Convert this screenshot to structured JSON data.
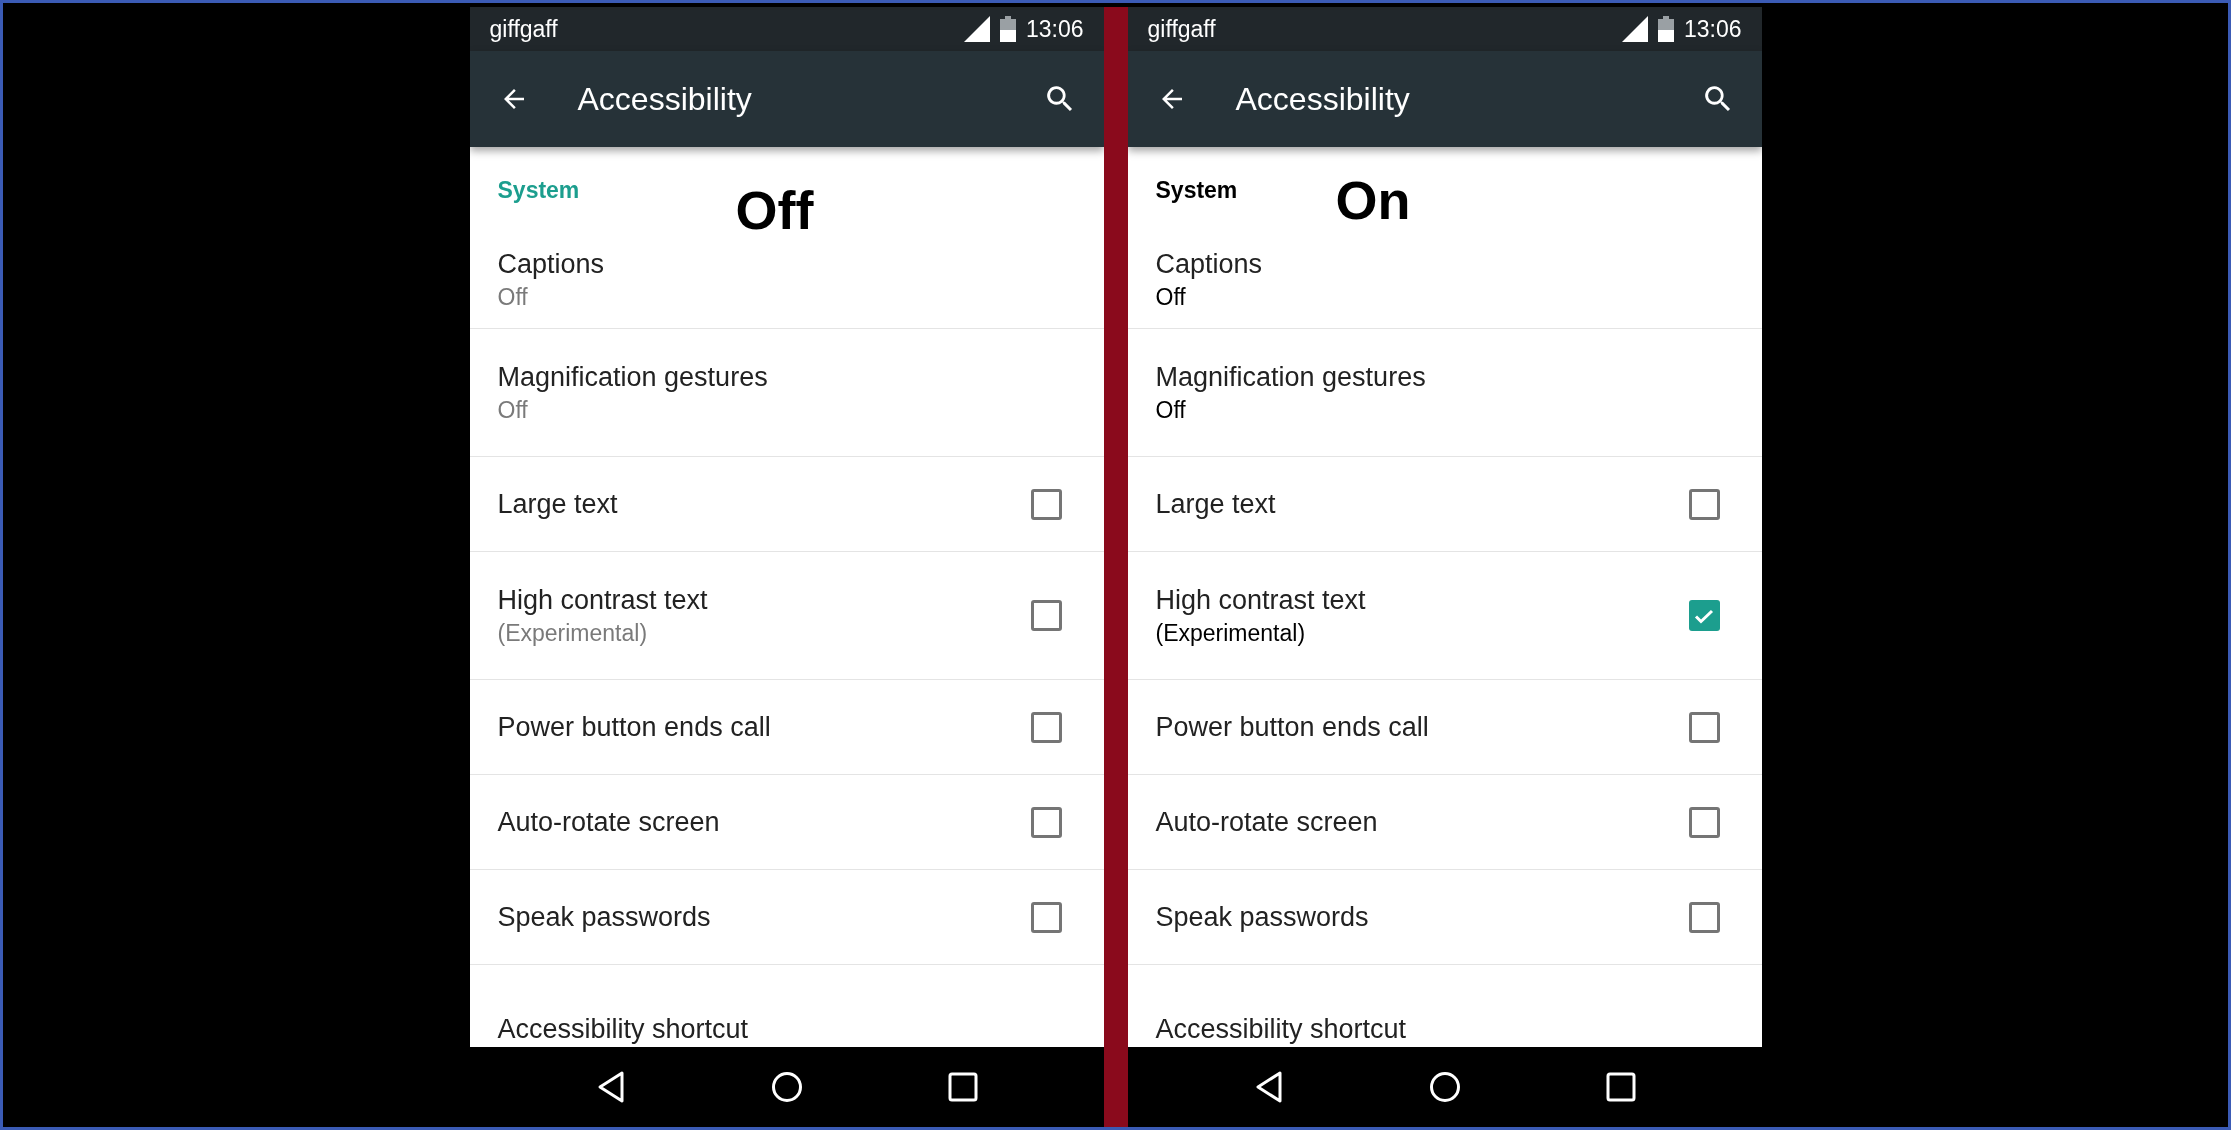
{
  "phones": [
    {
      "status_bar": {
        "carrier": "giffgaff",
        "time": "13:06"
      },
      "toolbar": {
        "title": "Accessibility"
      },
      "overlay_label": "Off",
      "high_contrast": false,
      "section_header": "System",
      "settings": [
        {
          "kind": "summary",
          "title": "Captions",
          "summary": "Off"
        },
        {
          "kind": "summary",
          "title": "Magnification gestures",
          "summary": "Off"
        },
        {
          "kind": "checkbox",
          "title": "Large text",
          "checked": false
        },
        {
          "kind": "checkbox",
          "title": "High contrast text",
          "summary": "(Experimental)",
          "checked": false
        },
        {
          "kind": "checkbox",
          "title": "Power button ends call",
          "checked": false
        },
        {
          "kind": "checkbox",
          "title": "Auto-rotate screen",
          "checked": false
        },
        {
          "kind": "checkbox",
          "title": "Speak passwords",
          "checked": false
        },
        {
          "kind": "summary",
          "title": "Accessibility shortcut"
        }
      ]
    },
    {
      "status_bar": {
        "carrier": "giffgaff",
        "time": "13:06"
      },
      "toolbar": {
        "title": "Accessibility"
      },
      "overlay_label": "On",
      "high_contrast": true,
      "section_header": "System",
      "settings": [
        {
          "kind": "summary",
          "title": "Captions",
          "summary": "Off"
        },
        {
          "kind": "summary",
          "title": "Magnification gestures",
          "summary": "Off"
        },
        {
          "kind": "checkbox",
          "title": "Large text",
          "checked": false
        },
        {
          "kind": "checkbox",
          "title": "High contrast text",
          "summary": "(Experimental)",
          "checked": true
        },
        {
          "kind": "checkbox",
          "title": "Power button ends call",
          "checked": false
        },
        {
          "kind": "checkbox",
          "title": "Auto-rotate screen",
          "checked": false
        },
        {
          "kind": "checkbox",
          "title": "Speak passwords",
          "checked": false
        },
        {
          "kind": "summary",
          "title": "Accessibility shortcut"
        }
      ]
    }
  ]
}
